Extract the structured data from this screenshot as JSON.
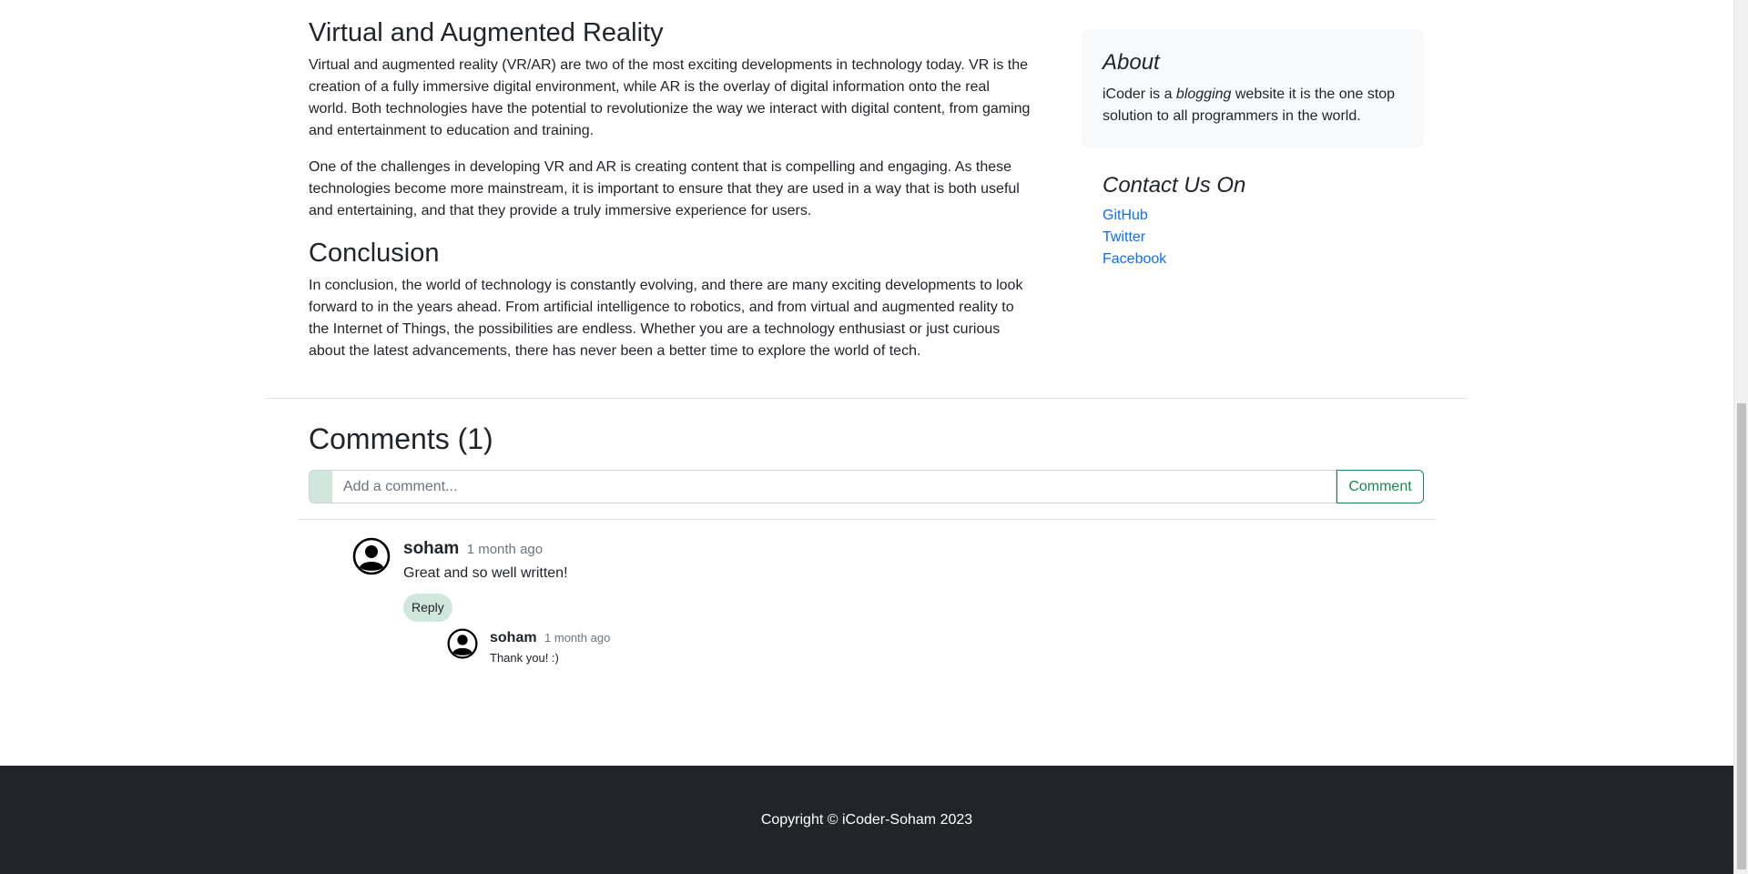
{
  "article": {
    "vr_heading": "Virtual and Augmented Reality",
    "vr_p1": "Virtual and augmented reality (VR/AR) are two of the most exciting developments in technology today. VR is the creation of a fully immersive digital environment, while AR is the overlay of digital information onto the real world. Both technologies have the potential to revolutionize the way we interact with digital content, from gaming and entertainment to education and training.",
    "vr_p2": "One of the challenges in developing VR and AR is creating content that is compelling and engaging. As these technologies become more mainstream, it is important to ensure that they are used in a way that is both useful and entertaining, and that they provide a truly immersive experience for users.",
    "conclusion_heading": "Conclusion",
    "conclusion_p": "In conclusion, the world of technology is constantly evolving, and there are many exciting developments to look forward to in the years ahead. From artificial intelligence to robotics, and from virtual and augmented reality to the Internet of Things, the possibilities are endless. Whether you are a technology enthusiast or just curious about the latest advancements, there has never been a better time to explore the world of tech."
  },
  "sidebar": {
    "about_title": "About",
    "about_text_before": "iCoder is a ",
    "about_text_em": "blogging",
    "about_text_after": " website it is the one stop solution to all programmers in the world.",
    "contact_title": "Contact Us On",
    "links": [
      "GitHub",
      "Twitter",
      "Facebook"
    ]
  },
  "comments": {
    "heading": "Comments (1)",
    "input_placeholder": "Add a comment...",
    "submit_label": "Comment",
    "items": [
      {
        "user": "soham",
        "time": "1 month ago",
        "text": "Great and so well written!",
        "reply_label": "Reply",
        "replies": [
          {
            "user": "soham",
            "time": "1 month ago",
            "text": "Thank you! :)"
          }
        ]
      }
    ]
  },
  "footer": {
    "copyright": "Copyright © iCoder-Soham 2023"
  },
  "colors": {
    "accent_green": "#198754",
    "light_green": "#d1e7dd",
    "link_blue": "#0d6efd",
    "footer_bg": "#212529"
  },
  "icons": {
    "avatar": "user-circle-icon"
  }
}
